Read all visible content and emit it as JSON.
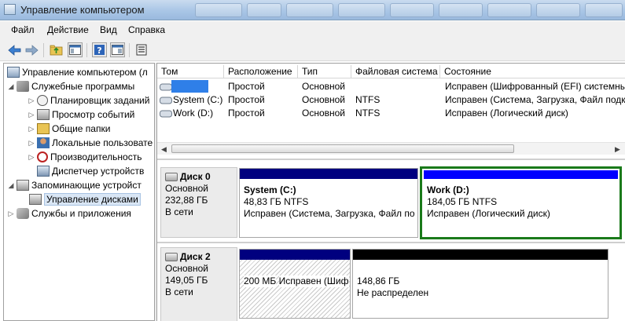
{
  "window": {
    "title": "Управление компьютером"
  },
  "menu": [
    "Файл",
    "Действие",
    "Вид",
    "Справка"
  ],
  "toolbar": {
    "icons": [
      "back-arrow-icon",
      "forward-arrow-icon",
      "up-folder-icon",
      "show-tree-icon",
      "help-icon",
      "properties-icon",
      "export-icon"
    ]
  },
  "tree": {
    "root": "Управление компьютером (л",
    "system_tools": "Служебные программы",
    "task_scheduler": "Планировщик заданий",
    "event_viewer": "Просмотр событий",
    "shared_folders": "Общие папки",
    "local_users": "Локальные пользовате",
    "performance": "Производительность",
    "device_manager": "Диспетчер устройств",
    "storage": "Запоминающие устройст",
    "disk_management": "Управление дисками",
    "services": "Службы и приложения"
  },
  "volumes": {
    "headers": [
      "Том",
      "Расположение",
      "Тип",
      "Файловая система",
      "Состояние"
    ],
    "rows": [
      {
        "volume": "",
        "layout": "Простой",
        "type": "Основной",
        "fs": "",
        "status": "Исправен (Шифрованный (EFI) системны"
      },
      {
        "volume": "System (C:)",
        "layout": "Простой",
        "type": "Основной",
        "fs": "NTFS",
        "status": "Исправен (Система, Загрузка, Файл подка"
      },
      {
        "volume": "Work (D:)",
        "layout": "Простой",
        "type": "Основной",
        "fs": "NTFS",
        "status": "Исправен (Логический диск)"
      }
    ]
  },
  "disks": [
    {
      "name": "Диск 0",
      "kind": "Основной",
      "size": "232,88 ГБ",
      "state": "В сети",
      "partitions": [
        {
          "name": "System (C:)",
          "size": "48,83 ГБ NTFS",
          "status": "Исправен (Система, Загрузка, Файл по"
        },
        {
          "name": "Work (D:)",
          "size": "184,05 ГБ NTFS",
          "status": "Исправен (Логический диск)"
        }
      ]
    },
    {
      "name": "Диск 2",
      "kind": "Основной",
      "size": "149,05 ГБ",
      "state": "В сети",
      "partitions": [
        {
          "name": "",
          "size": "200 МБ",
          "status": "Исправен (Шифрованн"
        },
        {
          "name": "",
          "size": "148,86 ГБ",
          "status": "Не распределен"
        }
      ]
    }
  ],
  "colors": {
    "primary_bar": "#00007f",
    "selected_bar": "#0000ff",
    "unallocated_bar": "#000000",
    "selected_border": "#1a7a1a",
    "redacted": "#2f7fe8"
  }
}
